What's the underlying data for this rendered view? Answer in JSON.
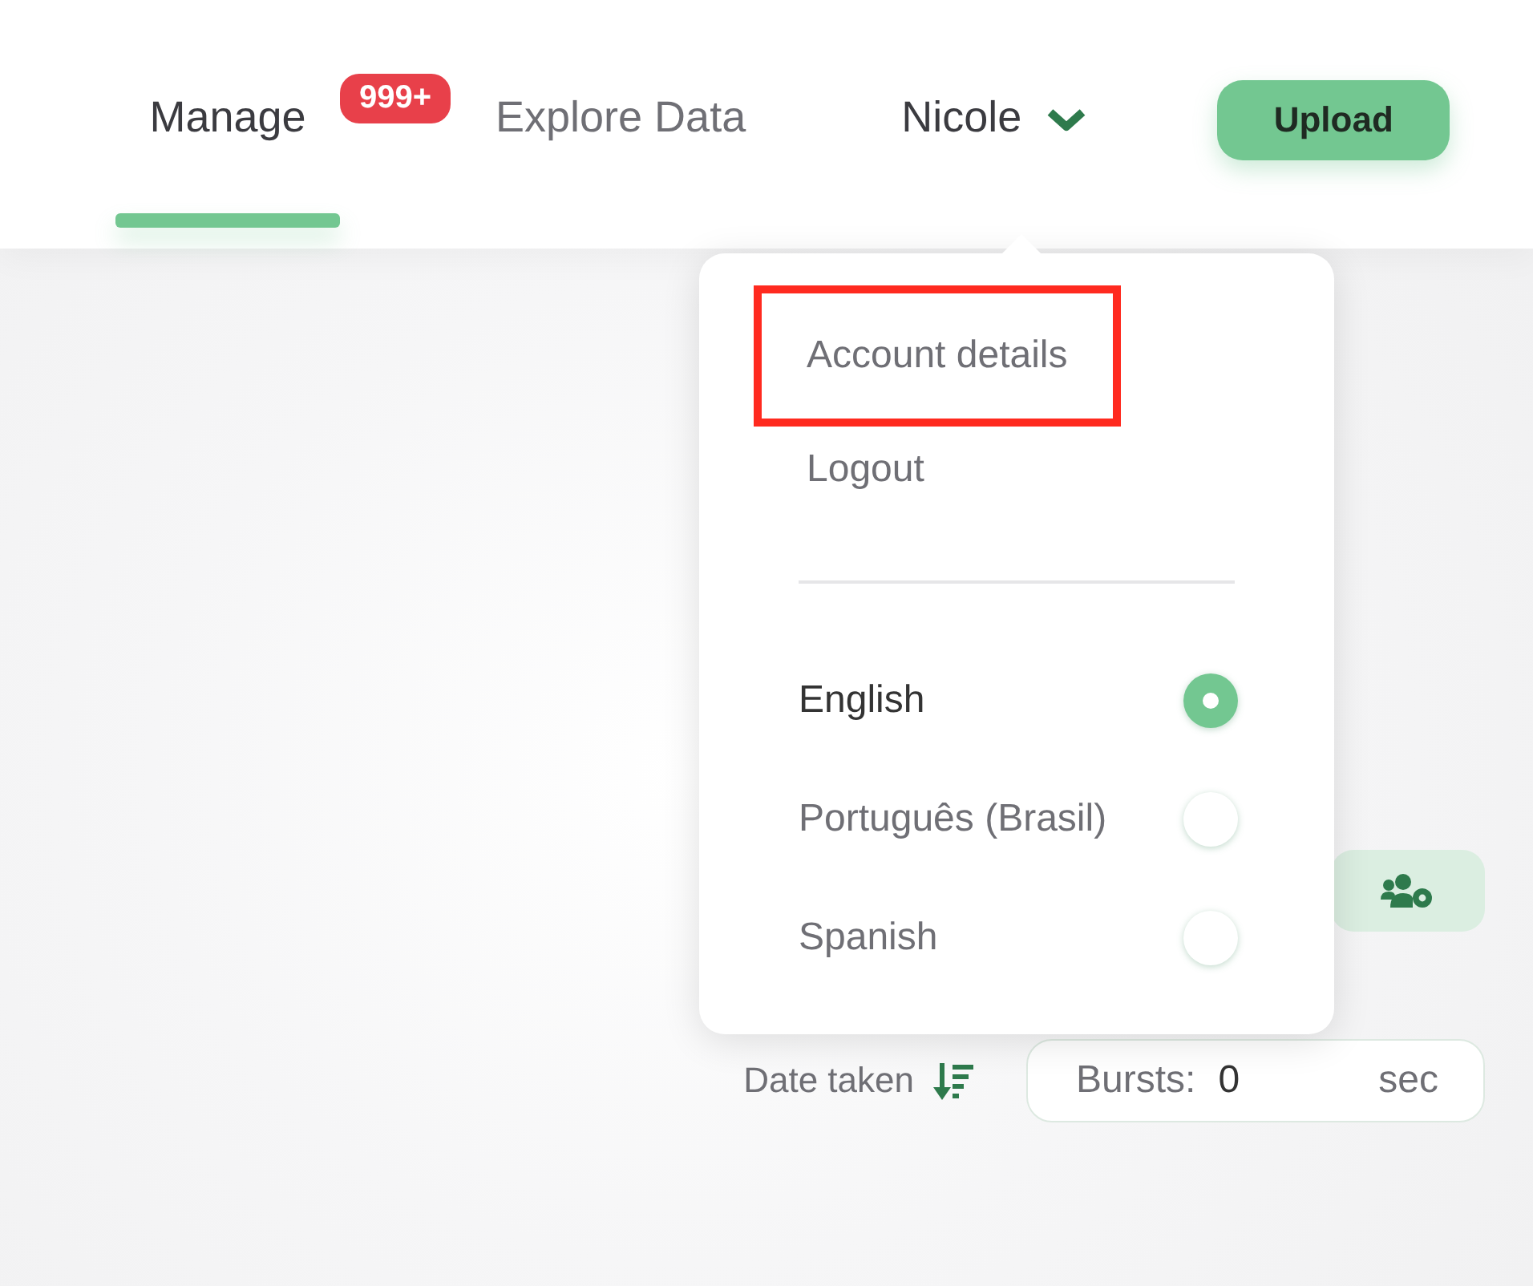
{
  "nav": {
    "tabs": [
      {
        "label": "Manage",
        "selected": true,
        "badge": "999+"
      },
      {
        "label": "Explore Data",
        "selected": false
      }
    ],
    "user": {
      "name": "Nicole",
      "expanded": true
    },
    "upload_button": "Upload"
  },
  "user_menu": {
    "items": [
      {
        "label": "Account details",
        "highlighted": true
      },
      {
        "label": "Logout",
        "highlighted": false
      }
    ],
    "languages": [
      {
        "label": "English",
        "selected": true
      },
      {
        "label": "Português (Brasil)",
        "selected": false
      },
      {
        "label": "Spanish",
        "selected": false
      }
    ]
  },
  "toolbar": {
    "sort_label": "Date taken",
    "bursts": {
      "label": "Bursts:",
      "value": "0",
      "unit": "sec"
    }
  }
}
